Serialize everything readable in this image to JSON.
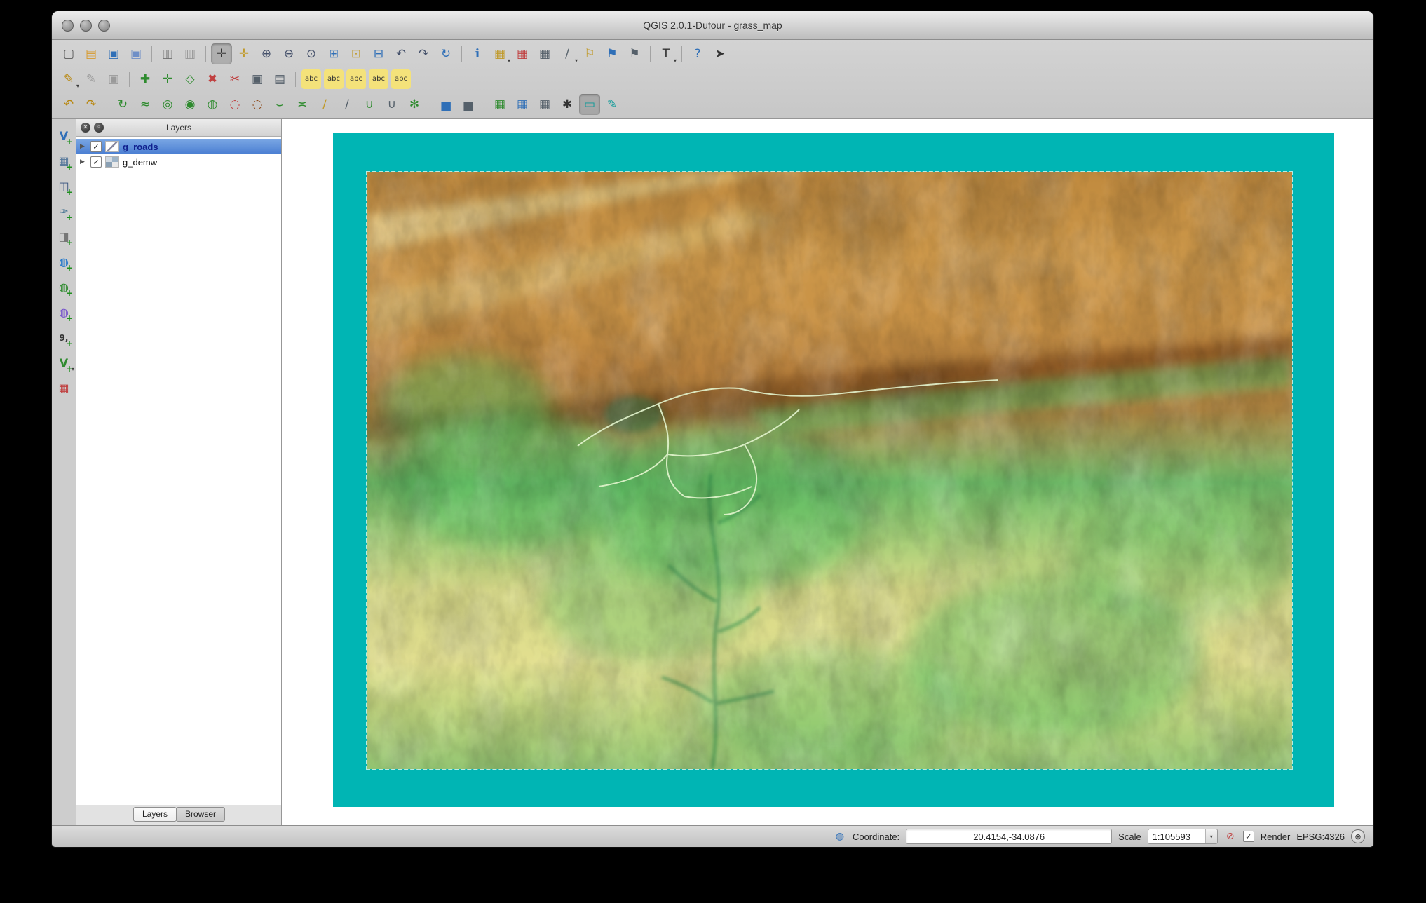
{
  "window": {
    "title": "QGIS 2.0.1-Dufour - grass_map"
  },
  "ui": {
    "dropdown_glyph": "▾",
    "disclosure_glyph": "▶",
    "check_glyph": "✓",
    "close_glyph": "✕",
    "float_glyph": "◦",
    "globe_glyph": "◍",
    "stop_glyph": "⊘",
    "crs_glyph": "⊕"
  },
  "toolbars": {
    "row1": [
      {
        "name": "new-project-icon",
        "glyph": "▢",
        "c": "#5a5a5a",
        "inter": "true"
      },
      {
        "name": "open-project-icon",
        "glyph": "▤",
        "c": "#d79a2e",
        "inter": "true"
      },
      {
        "name": "save-project-icon",
        "glyph": "▣",
        "c": "#2f6fb7",
        "inter": "true"
      },
      {
        "name": "save-project-as-icon",
        "glyph": "▣",
        "c": "#6f8fc7",
        "inter": "true"
      },
      {
        "name": "separator",
        "sep": true,
        "glyph": "",
        "inter": "false"
      },
      {
        "name": "new-composer-icon",
        "glyph": "▥",
        "c": "#707070",
        "inter": "true"
      },
      {
        "name": "composer-manager-icon",
        "glyph": "▥",
        "c": "#989898",
        "inter": "true"
      },
      {
        "name": "separator",
        "sep": true,
        "glyph": "",
        "inter": "false"
      },
      {
        "name": "pan-map-icon",
        "glyph": "✛",
        "c": "#333333",
        "pressed": true,
        "inter": "true"
      },
      {
        "name": "pan-to-selection-icon",
        "glyph": "✛",
        "c": "#c09a2a",
        "inter": "true"
      },
      {
        "name": "zoom-in-icon",
        "glyph": "⊕",
        "c": "#44506a",
        "inter": "true"
      },
      {
        "name": "zoom-out-icon",
        "glyph": "⊖",
        "c": "#44506a",
        "inter": "true"
      },
      {
        "name": "zoom-native-icon",
        "glyph": "⊙",
        "c": "#44506a",
        "inter": "true"
      },
      {
        "name": "zoom-full-icon",
        "glyph": "⊞",
        "c": "#2f6fb7",
        "inter": "true"
      },
      {
        "name": "zoom-to-selection-icon",
        "glyph": "⊡",
        "c": "#c09a2a",
        "inter": "true"
      },
      {
        "name": "zoom-to-layer-icon",
        "glyph": "⊟",
        "c": "#2f6fb7",
        "inter": "true"
      },
      {
        "name": "zoom-last-icon",
        "glyph": "↶",
        "c": "#44506a",
        "inter": "true"
      },
      {
        "name": "zoom-next-icon",
        "glyph": "↷",
        "c": "#44506a",
        "inter": "true"
      },
      {
        "name": "refresh-map-icon",
        "glyph": "↻",
        "c": "#2f6fb7",
        "inter": "true"
      },
      {
        "name": "separator",
        "sep": true,
        "glyph": "",
        "inter": "false"
      },
      {
        "name": "identify-features-icon",
        "glyph": "ℹ",
        "c": "#2f6fb7",
        "inter": "true"
      },
      {
        "name": "select-features-icon",
        "glyph": "▦",
        "c": "#c09a2a",
        "dd": true,
        "inter": "true"
      },
      {
        "name": "deselect-features-icon",
        "glyph": "▦",
        "c": "#c04040",
        "inter": "true"
      },
      {
        "name": "attribute-table-icon",
        "glyph": "▦",
        "c": "#55606a",
        "inter": "true"
      },
      {
        "name": "measure-icon",
        "glyph": "∕",
        "c": "#55606a",
        "dd": true,
        "inter": "true"
      },
      {
        "name": "map-tips-icon",
        "glyph": "⚐",
        "c": "#c09a2a",
        "inter": "true"
      },
      {
        "name": "new-bookmark-icon",
        "glyph": "⚑",
        "c": "#2f6fb7",
        "inter": "true"
      },
      {
        "name": "show-bookmarks-icon",
        "glyph": "⚑",
        "c": "#55606a",
        "inter": "true"
      },
      {
        "name": "separator",
        "sep": true,
        "glyph": "",
        "inter": "false"
      },
      {
        "name": "text-annotation-icon",
        "glyph": "T",
        "c": "#333333",
        "dd": true,
        "inter": "true"
      },
      {
        "name": "separator",
        "sep": true,
        "glyph": "",
        "inter": "false"
      },
      {
        "name": "help-icon",
        "glyph": "?",
        "c": "#2f6fb7",
        "inter": "true"
      },
      {
        "name": "whats-this-icon",
        "glyph": "➤",
        "c": "#333333",
        "inter": "true"
      }
    ],
    "row2": [
      {
        "name": "current-edits-icon",
        "glyph": "✎",
        "c": "#b8860b",
        "dd": true,
        "inter": "true"
      },
      {
        "name": "toggle-editing-icon",
        "glyph": "✎",
        "c": "#9a9a9a",
        "inter": "true"
      },
      {
        "name": "save-layer-edits-icon",
        "glyph": "▣",
        "c": "#9a9a9a",
        "inter": "true"
      },
      {
        "name": "separator",
        "sep": true,
        "glyph": "",
        "inter": "false"
      },
      {
        "name": "add-feature-icon",
        "glyph": "✚",
        "c": "#2e8b2e",
        "inter": "true"
      },
      {
        "name": "move-feature-icon",
        "glyph": "✛",
        "c": "#2e8b2e",
        "inter": "true"
      },
      {
        "name": "node-tool-icon",
        "glyph": "◇",
        "c": "#2e8b2e",
        "inter": "true"
      },
      {
        "name": "delete-selected-icon",
        "glyph": "✖",
        "c": "#c04040",
        "inter": "true"
      },
      {
        "name": "cut-features-icon",
        "glyph": "✂",
        "c": "#c04040",
        "inter": "true"
      },
      {
        "name": "copy-features-icon",
        "glyph": "▣",
        "c": "#55606a",
        "inter": "true"
      },
      {
        "name": "paste-features-icon",
        "glyph": "▤",
        "c": "#55606a",
        "inter": "true"
      },
      {
        "name": "separator",
        "sep": true,
        "glyph": "",
        "inter": "false"
      },
      {
        "name": "labeling-icon",
        "glyph": "abc",
        "c": "#333333",
        "bg": "#f4e27a",
        "fs": "10px",
        "inter": "true"
      },
      {
        "name": "label-pin-icon",
        "glyph": "abc",
        "c": "#333333",
        "bg": "#f4e27a",
        "fs": "10px",
        "inter": "true"
      },
      {
        "name": "label-show-hide-icon",
        "glyph": "abc",
        "c": "#333333",
        "bg": "#f4e27a",
        "fs": "10px",
        "inter": "true"
      },
      {
        "name": "label-move-rotate-icon",
        "glyph": "abc",
        "c": "#333333",
        "bg": "#f4e27a",
        "fs": "10px",
        "inter": "true"
      },
      {
        "name": "label-properties-icon",
        "glyph": "abc",
        "c": "#333333",
        "bg": "#f4e27a",
        "fs": "10px",
        "inter": "true"
      }
    ],
    "row3": [
      {
        "name": "undo-icon",
        "glyph": "↶",
        "c": "#b8860b",
        "inter": "true"
      },
      {
        "name": "redo-icon",
        "glyph": "↷",
        "c": "#b8860b",
        "inter": "true"
      },
      {
        "name": "separator",
        "sep": true,
        "glyph": "",
        "inter": "false"
      },
      {
        "name": "rotate-feature-icon",
        "glyph": "↻",
        "c": "#2e8b2e",
        "inter": "true"
      },
      {
        "name": "simplify-feature-icon",
        "glyph": "≈",
        "c": "#2e8b2e",
        "inter": "true"
      },
      {
        "name": "add-ring-icon",
        "glyph": "◎",
        "c": "#2e8b2e",
        "inter": "true"
      },
      {
        "name": "add-part-icon",
        "glyph": "◉",
        "c": "#2e8b2e",
        "inter": "true"
      },
      {
        "name": "fill-ring-icon",
        "glyph": "◍",
        "c": "#2e8b2e",
        "inter": "true"
      },
      {
        "name": "delete-ring-icon",
        "glyph": "◌",
        "c": "#c04040",
        "inter": "true"
      },
      {
        "name": "delete-part-icon",
        "glyph": "◌",
        "c": "#8b4513",
        "inter": "true"
      },
      {
        "name": "reshape-features-icon",
        "glyph": "⌣",
        "c": "#2e8b2e",
        "inter": "true"
      },
      {
        "name": "offset-curve-icon",
        "glyph": "≍",
        "c": "#2e8b2e",
        "inter": "true"
      },
      {
        "name": "split-features-icon",
        "glyph": "∕",
        "c": "#c09a2a",
        "inter": "true"
      },
      {
        "name": "split-parts-icon",
        "glyph": "∕",
        "c": "#55606a",
        "inter": "true"
      },
      {
        "name": "merge-features-icon",
        "glyph": "∪",
        "c": "#2e8b2e",
        "inter": "true"
      },
      {
        "name": "merge-attributes-icon",
        "glyph": "∪",
        "c": "#55606a",
        "inter": "true"
      },
      {
        "name": "rotate-point-symbols-icon",
        "glyph": "✻",
        "c": "#2e8b2e",
        "inter": "true"
      },
      {
        "name": "separator",
        "sep": true,
        "glyph": "",
        "inter": "false"
      },
      {
        "name": "raster-local-stretch-icon",
        "glyph": "▅",
        "c": "#2f6fb7",
        "inter": "true"
      },
      {
        "name": "raster-full-stretch-icon",
        "glyph": "▅",
        "c": "#55606a",
        "inter": "true"
      },
      {
        "name": "separator",
        "sep": true,
        "glyph": "",
        "inter": "false"
      },
      {
        "name": "grass-open-mapset-icon",
        "glyph": "▦",
        "c": "#2e8b2e",
        "inter": "true"
      },
      {
        "name": "grass-new-mapset-icon",
        "glyph": "▦",
        "c": "#2f6fb7",
        "inter": "true"
      },
      {
        "name": "grass-close-mapset-icon",
        "glyph": "▦",
        "c": "#55606a",
        "inter": "true"
      },
      {
        "name": "grass-tools-icon",
        "glyph": "✱",
        "c": "#333333",
        "inter": "true"
      },
      {
        "name": "grass-region-icon",
        "glyph": "▭",
        "c": "#0a9a98",
        "pressed": true,
        "inter": "true"
      },
      {
        "name": "grass-edit-region-icon",
        "glyph": "✎",
        "c": "#0a9a98",
        "inter": "true"
      }
    ],
    "side": [
      {
        "name": "add-vector-layer-icon",
        "glyph": "V",
        "c": "#2f6fb7",
        "badge": "+",
        "inter": "true"
      },
      {
        "name": "add-raster-layer-icon",
        "glyph": "▦",
        "c": "#55779a",
        "badge": "+",
        "inter": "true"
      },
      {
        "name": "add-postgis-layer-icon",
        "glyph": "◫",
        "c": "#334f7d",
        "badge": "+",
        "inter": "true"
      },
      {
        "name": "add-spatialite-layer-icon",
        "glyph": "✑",
        "c": "#3f6f8f",
        "badge": "+",
        "inter": "true"
      },
      {
        "name": "add-mssql-layer-icon",
        "glyph": "◨",
        "c": "#777777",
        "badge": "+",
        "inter": "true"
      },
      {
        "name": "add-wms-layer-icon",
        "glyph": "◍",
        "c": "#2277cc",
        "badge": "+",
        "inter": "true"
      },
      {
        "name": "add-wcs-layer-icon",
        "glyph": "◍",
        "c": "#2e8b2e",
        "badge": "+",
        "inter": "true"
      },
      {
        "name": "add-wfs-layer-icon",
        "glyph": "◍",
        "c": "#7755cc",
        "badge": "+",
        "inter": "true"
      },
      {
        "name": "add-delimited-text-icon",
        "glyph": "9,",
        "c": "#333333",
        "fs": "12px",
        "badge": "+",
        "inter": "true"
      },
      {
        "name": "new-shapefile-layer-icon",
        "glyph": "V",
        "c": "#2e8b2e",
        "dd": true,
        "badge": "+",
        "inter": "true"
      },
      {
        "name": "remove-layer-icon",
        "glyph": "▦",
        "c": "#c04040",
        "badge": "",
        "inter": "true"
      }
    ]
  },
  "layers_panel": {
    "title": "Layers",
    "layers": [
      {
        "row_name": "layer-row-g-roads",
        "label": "g_roads",
        "checked": true,
        "selected": true,
        "line": true,
        "raster": false
      },
      {
        "row_name": "layer-row-g-demw",
        "label": "g_demw",
        "checked": true,
        "selected": false,
        "line": false,
        "raster": true
      }
    ],
    "tabs": [
      {
        "name": "tab-layers",
        "label": "Layers",
        "active": true
      },
      {
        "name": "tab-browser",
        "label": "Browser",
        "active": false
      }
    ]
  },
  "map": {
    "region_color": "#00b5b4"
  },
  "status_bar": {
    "coordinate_label": "Coordinate:",
    "coordinate_value": "20.4154,-34.0876",
    "scale_label": "Scale",
    "scale_value": "1:105593",
    "render_label": "Render",
    "render_checked": true,
    "crs_label": "EPSG:4326"
  }
}
